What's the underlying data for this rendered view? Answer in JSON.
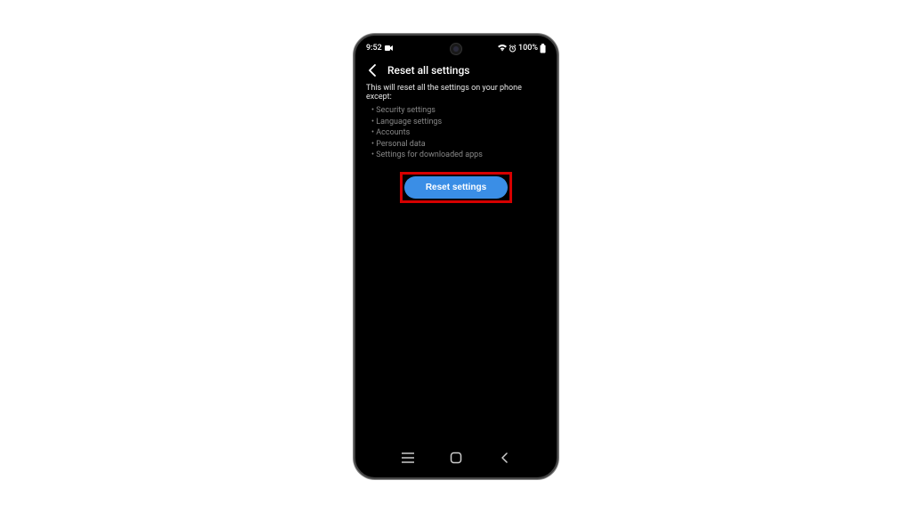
{
  "status": {
    "time": "9:52",
    "battery": "100%"
  },
  "header": {
    "title": "Reset all settings"
  },
  "content": {
    "description": "This will reset all the settings on your phone except:",
    "exceptions": [
      "Security settings",
      "Language settings",
      "Accounts",
      "Personal data",
      "Settings for downloaded apps"
    ],
    "button_label": "Reset settings"
  }
}
